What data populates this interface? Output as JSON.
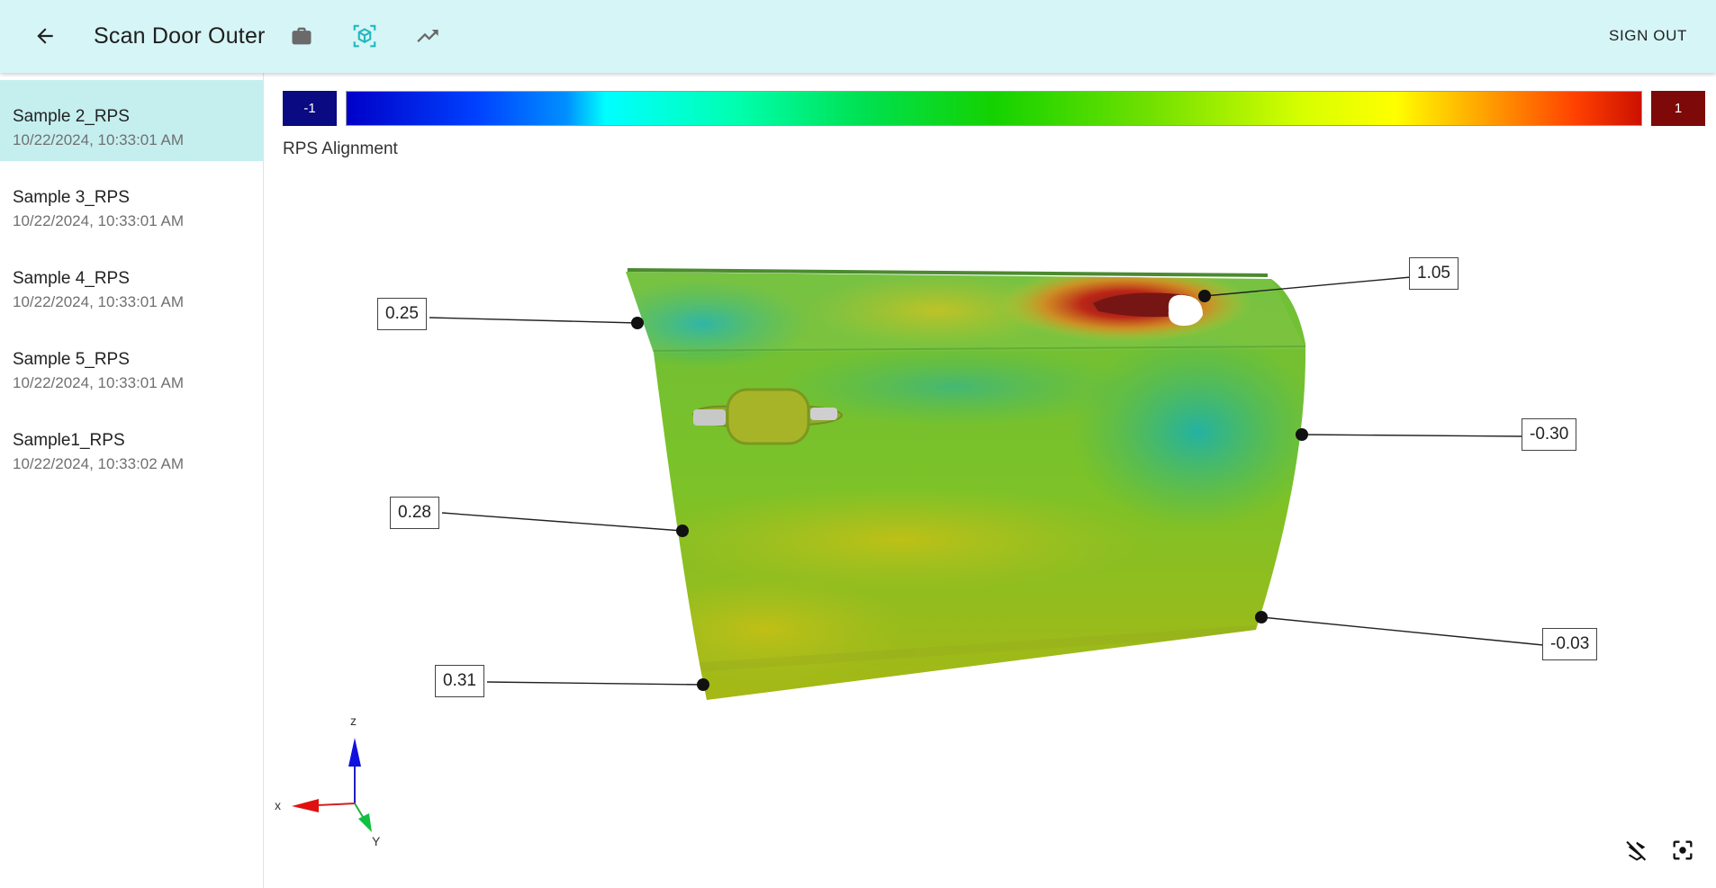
{
  "header": {
    "title": "Scan Door Outer",
    "sign_out_label": "SIGN OUT",
    "icons": [
      "arrow-back-icon",
      "briefcase-icon",
      "3d-scan-icon",
      "trending-up-icon"
    ],
    "accent_color": "#20b8c0",
    "background_color": "#d6f5f6"
  },
  "sidebar": {
    "items": [
      {
        "name": "Sample 2_RPS",
        "date": "10/22/2024, 10:33:01 AM",
        "active": true
      },
      {
        "name": "Sample 3_RPS",
        "date": "10/22/2024, 10:33:01 AM",
        "active": false
      },
      {
        "name": "Sample 4_RPS",
        "date": "10/22/2024, 10:33:01 AM",
        "active": false
      },
      {
        "name": "Sample 5_RPS",
        "date": "10/22/2024, 10:33:01 AM",
        "active": false
      },
      {
        "name": "Sample1_RPS",
        "date": "10/22/2024, 10:33:02 AM",
        "active": false
      }
    ]
  },
  "colorbar": {
    "min_label": "-1",
    "max_label": "1",
    "min_color": "#0a0a82",
    "max_color": "#7d0a08"
  },
  "viewer": {
    "label": "RPS Alignment",
    "callouts": [
      "0.25",
      "0.28",
      "0.31",
      "1.05",
      "-0.30",
      "-0.03"
    ],
    "axes": {
      "x": "x",
      "y": "Y",
      "z": "z"
    },
    "tools": [
      "layers-off-icon",
      "center-focus-icon"
    ]
  }
}
